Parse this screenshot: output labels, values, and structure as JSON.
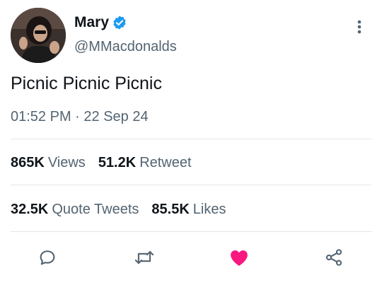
{
  "author": {
    "name": "Mary",
    "handle": "@MMacdonalds",
    "verified": true,
    "avatar_icon": "profile-photo",
    "verified_color": "#1d9bf0"
  },
  "tweet": {
    "text": "Picnic Picnic Picnic",
    "time": "01:52 PM",
    "separator": "·",
    "date": "22 Sep 24"
  },
  "stats_row1": [
    {
      "count": "865K",
      "label": "Views"
    },
    {
      "count": "51.2K",
      "label": "Retweet"
    }
  ],
  "stats_row2": [
    {
      "count": "32.5K",
      "label": "Quote Tweets"
    },
    {
      "count": "85.5K",
      "label": "Likes"
    }
  ],
  "actions": {
    "reply_icon": "reply-icon",
    "retweet_icon": "retweet-icon",
    "like_icon": "heart-icon",
    "share_icon": "share-icon",
    "liked": true,
    "like_color": "#f91880",
    "icon_color": "#536471"
  }
}
